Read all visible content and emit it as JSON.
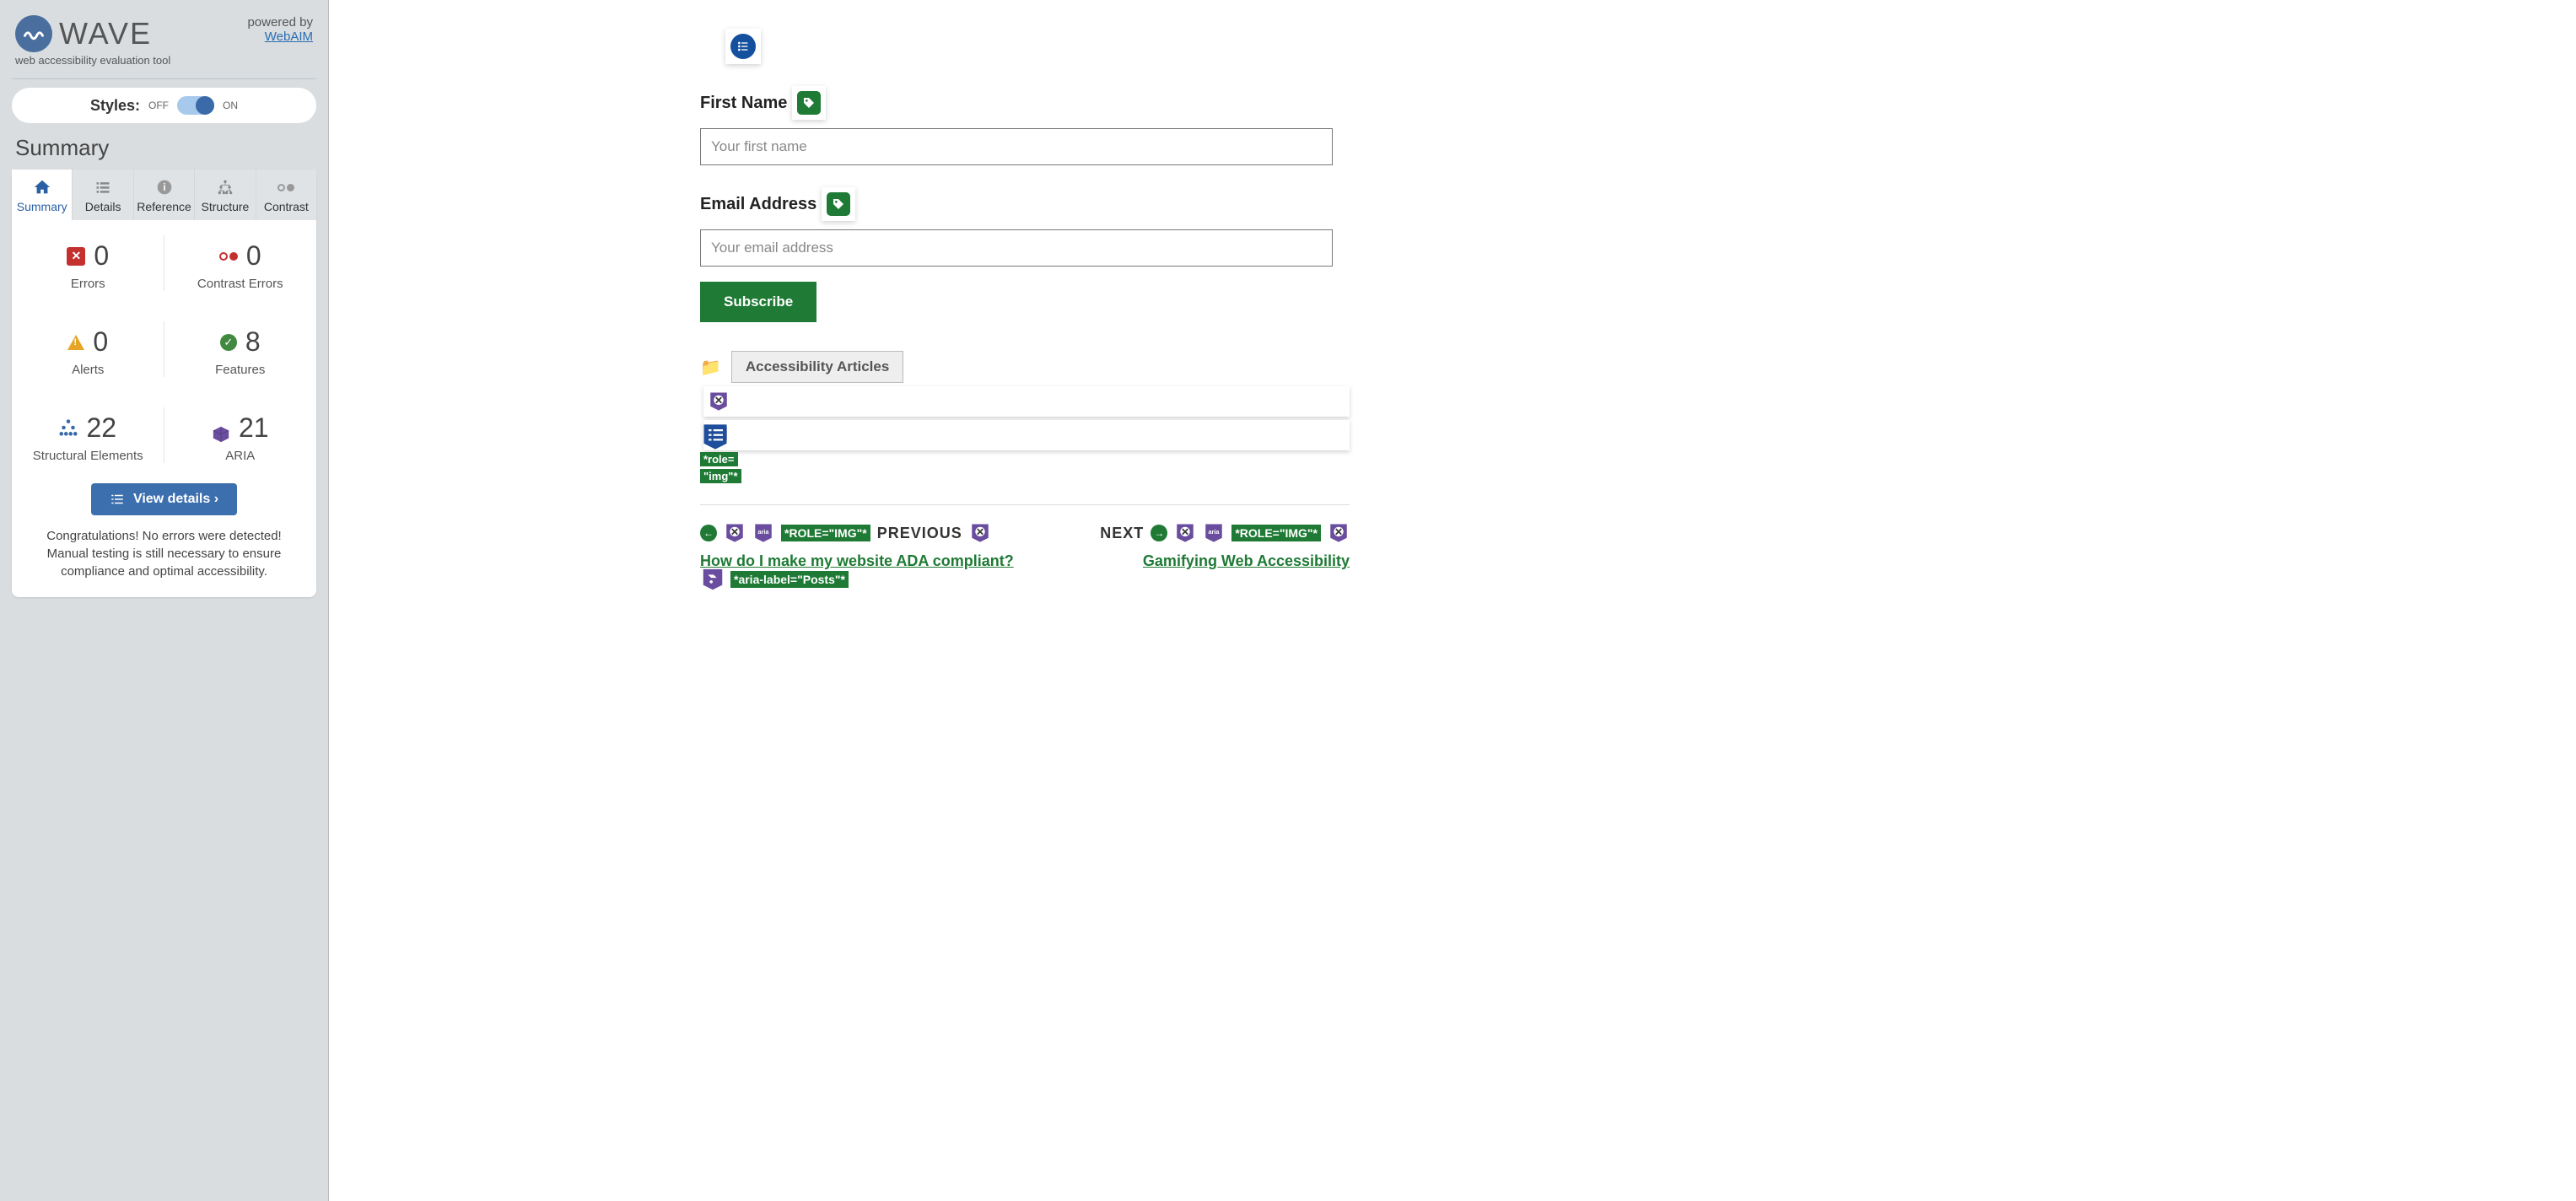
{
  "brand": "WAVE",
  "subtitle": "web accessibility evaluation tool",
  "powered_prefix": "powered by",
  "powered_link": "WebAIM",
  "styles_label": "Styles:",
  "styles_off": "OFF",
  "styles_on": "ON",
  "summary_heading": "Summary",
  "tabs": {
    "summary": "Summary",
    "details": "Details",
    "reference": "Reference",
    "structure": "Structure",
    "contrast": "Contrast"
  },
  "counts": {
    "errors": {
      "n": "0",
      "label": "Errors"
    },
    "contrast": {
      "n": "0",
      "label": "Contrast Errors"
    },
    "alerts": {
      "n": "0",
      "label": "Alerts"
    },
    "features": {
      "n": "8",
      "label": "Features"
    },
    "structural": {
      "n": "22",
      "label": "Structural Elements"
    },
    "aria": {
      "n": "21",
      "label": "ARIA"
    }
  },
  "view_details": "View details ›",
  "congrats": "Congratulations! No errors were detected! Manual testing is still necessary to ensure compliance and optimal accessibility.",
  "form": {
    "first_name_label": "First Name",
    "first_name_ph": "Your first name",
    "email_label": "Email Address",
    "email_ph": "Your email address",
    "subscribe": "Subscribe"
  },
  "category_tag": "Accessibility Articles",
  "role_img_a": "*role=",
  "role_img_b": "\"img\"*",
  "aria_label_posts": "*aria-label=\"Posts\"*",
  "nav": {
    "prev_word": "PREVIOUS",
    "prev_role": "*ROLE=\"IMG\"*",
    "prev_link": "How do I make my website ADA compliant?",
    "next_word": "NEXT",
    "next_role": "*ROLE=\"IMG\"*",
    "next_link": "Gamifying Web Accessibility"
  }
}
